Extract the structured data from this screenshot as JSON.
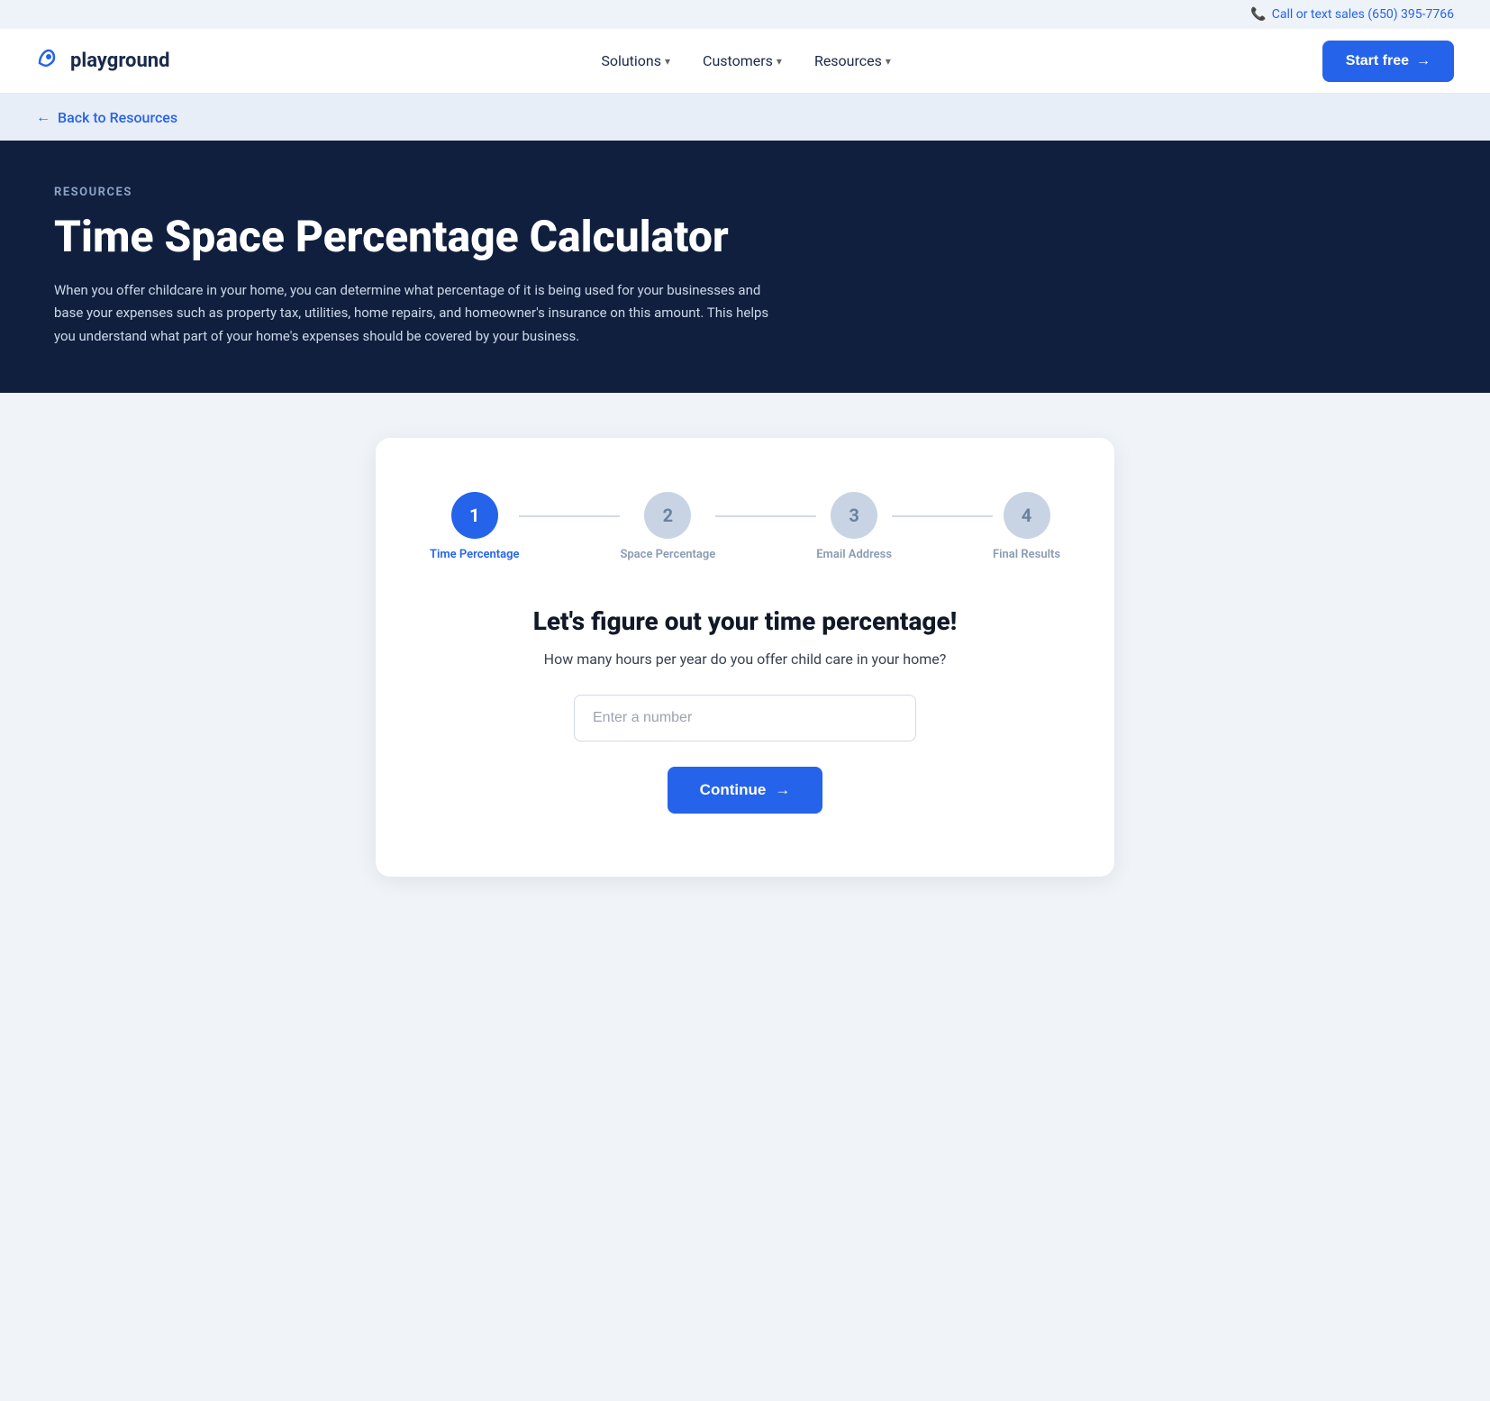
{
  "topbar": {
    "phone_label": "Call or text sales (650) 395-7766"
  },
  "navbar": {
    "brand_name": "playground",
    "nav_items": [
      {
        "label": "Solutions",
        "has_dropdown": true
      },
      {
        "label": "Customers",
        "has_dropdown": true
      },
      {
        "label": "Resources",
        "has_dropdown": true
      }
    ],
    "cta_label": "Start free"
  },
  "back_bar": {
    "link_label": "Back to Resources"
  },
  "hero": {
    "section_label": "RESOURCES",
    "title": "Time Space Percentage Calculator",
    "description": "When you offer childcare in your home, you can determine what percentage of it is being used for your businesses and base your expenses such as property tax, utilities, home repairs, and homeowner's insurance on this amount. This helps you understand what part of your home's expenses should be covered by your business."
  },
  "calculator": {
    "steps": [
      {
        "number": "1",
        "label": "Time Percentage",
        "state": "active"
      },
      {
        "number": "2",
        "label": "Space Percentage",
        "state": "inactive"
      },
      {
        "number": "3",
        "label": "Email Address",
        "state": "inactive"
      },
      {
        "number": "4",
        "label": "Final Results",
        "state": "inactive"
      }
    ],
    "form_title": "Let's figure out your time percentage!",
    "form_subtitle": "How many hours per year do you offer child care in your home?",
    "input_placeholder": "Enter a number",
    "continue_label": "Continue"
  }
}
